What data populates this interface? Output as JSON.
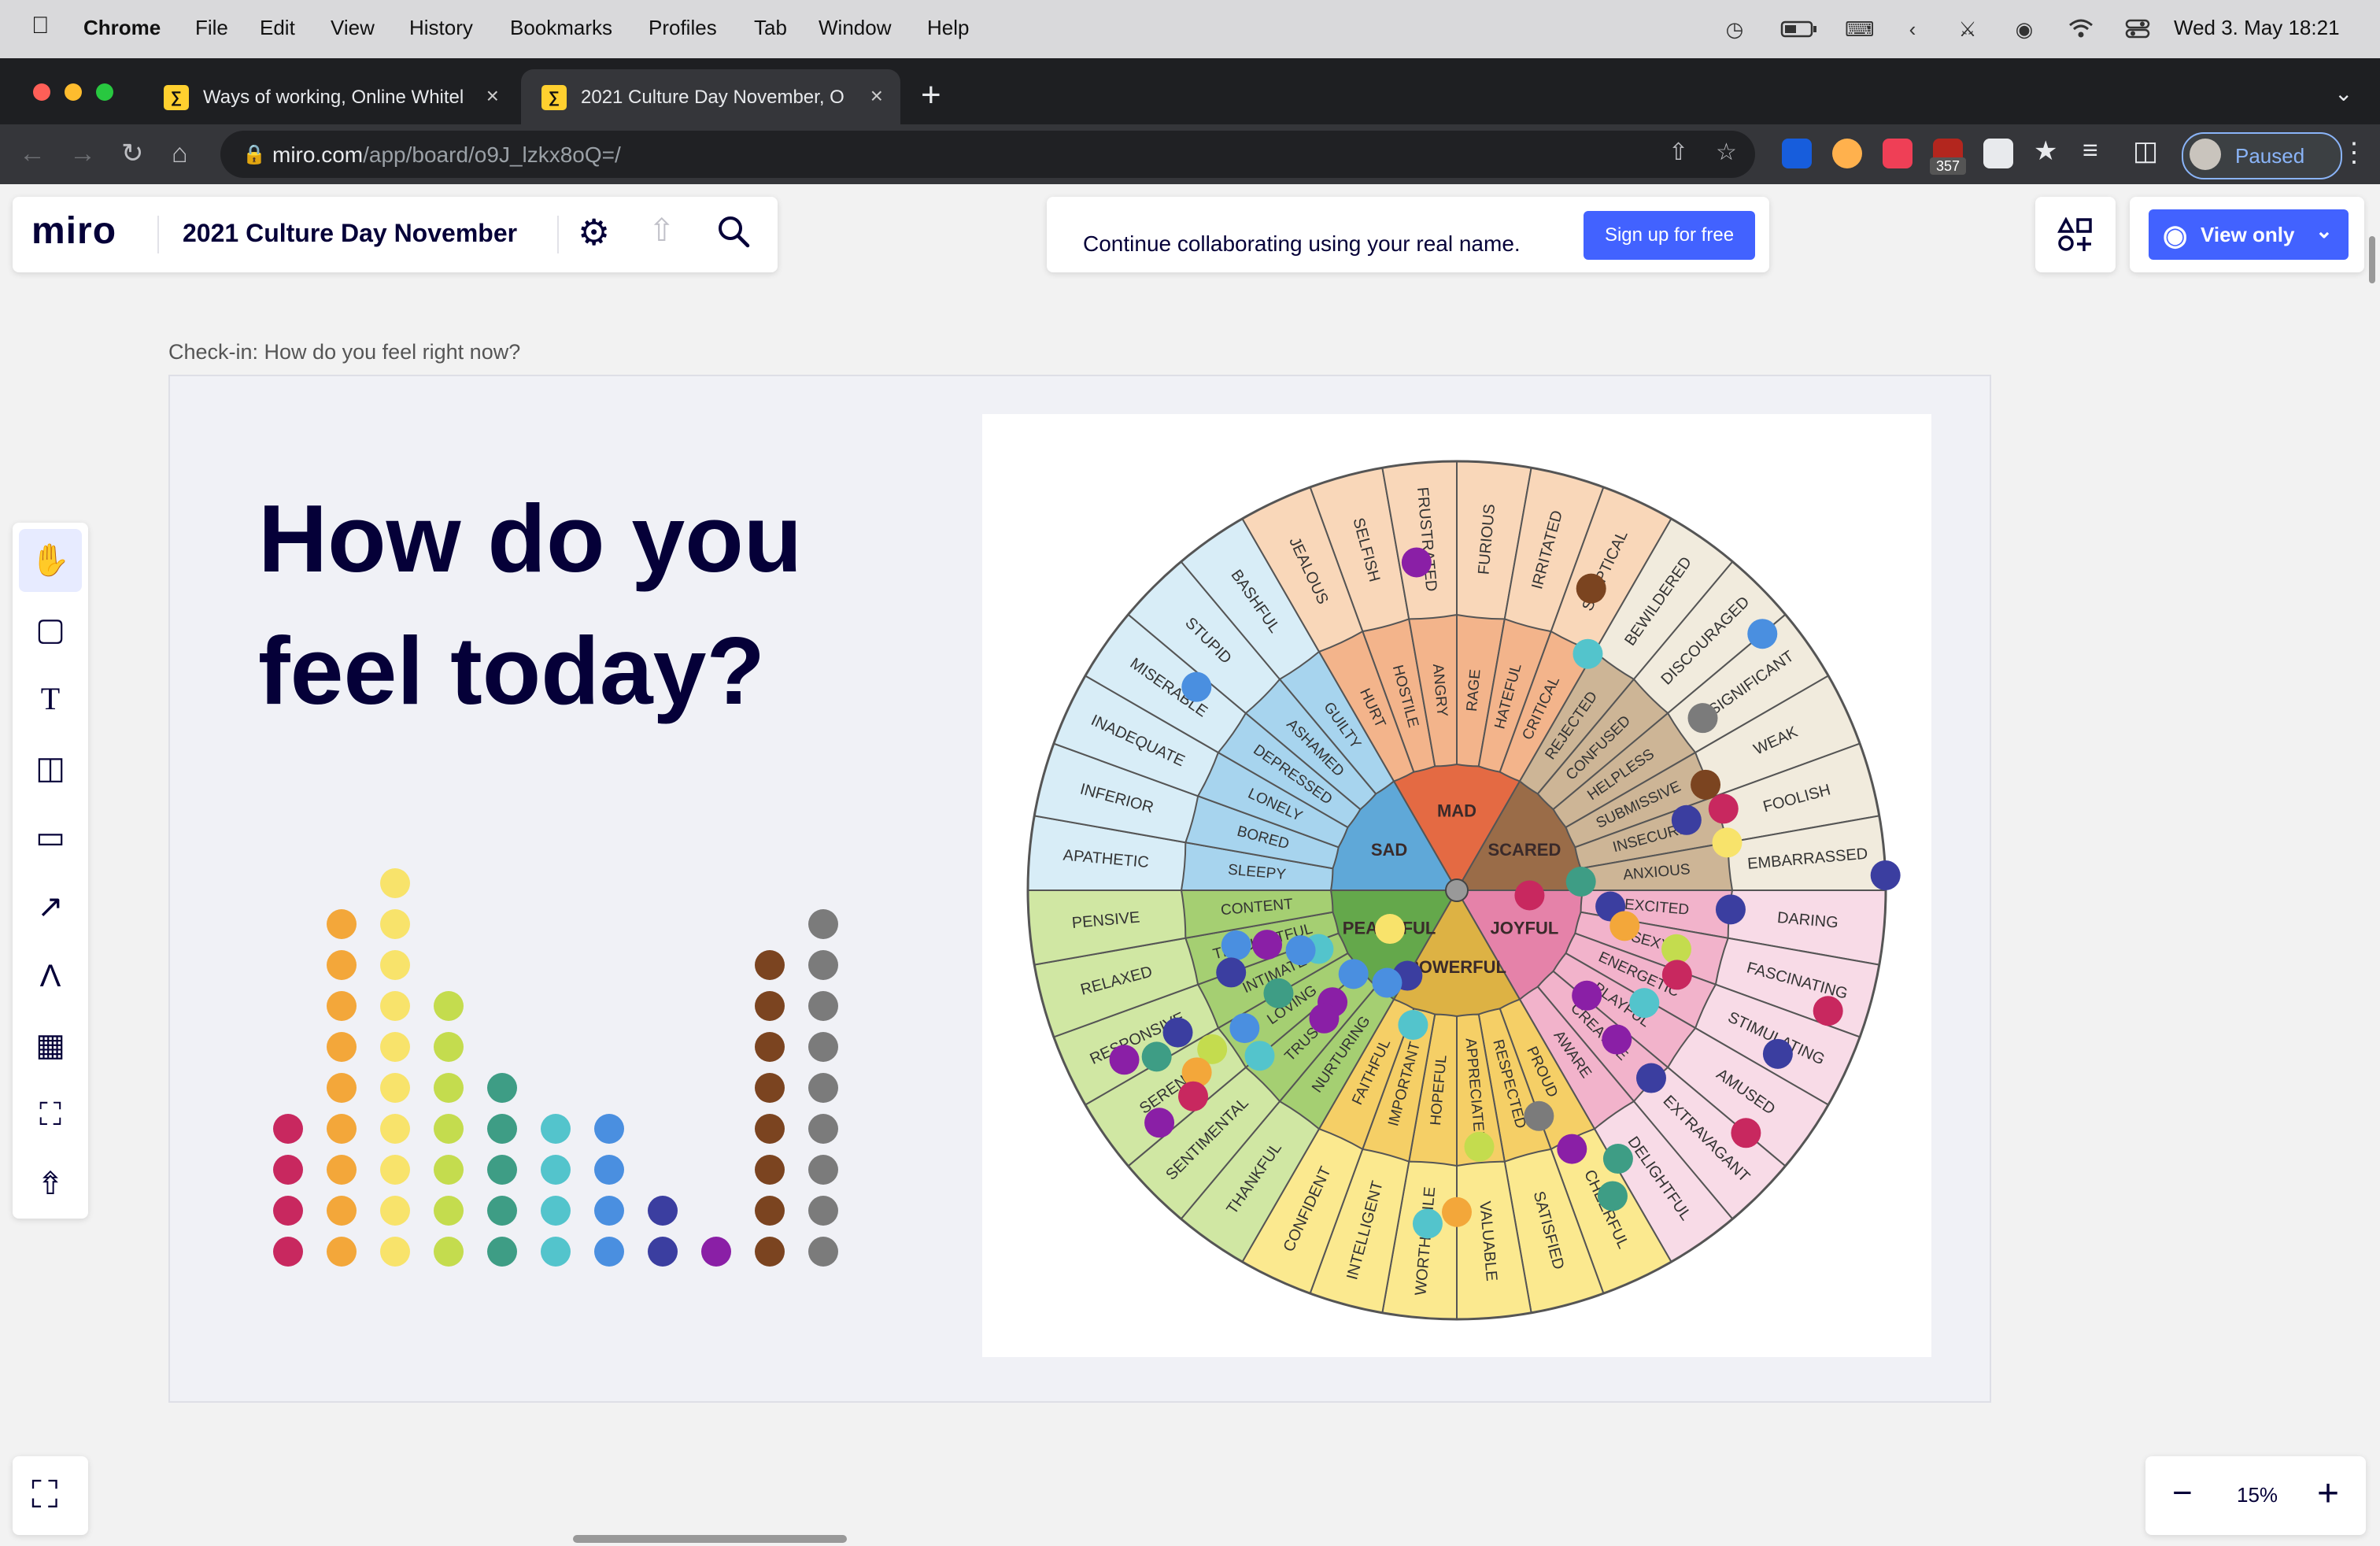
{
  "menubar": {
    "apple": "",
    "app": "Chrome",
    "items": [
      "File",
      "Edit",
      "View",
      "History",
      "Bookmarks",
      "Profiles",
      "Tab",
      "Window",
      "Help"
    ],
    "clock": "Wed 3. May  18:21"
  },
  "browser": {
    "tabs": [
      {
        "title": "Ways of working, Online Whitel",
        "favicon": "miro-icon"
      },
      {
        "title": "2021 Culture Day November, O",
        "favicon": "miro-icon"
      }
    ],
    "url_host": "miro.com",
    "url_path": "/app/board/o9J_lzkx8oQ=/",
    "extension_badge": "357",
    "profile_label": "Paused"
  },
  "miro": {
    "logo": "miro",
    "board_name": "2021 Culture Day November",
    "banner_text": "Continue collaborating using your real name.",
    "signup_label": "Sign up for free",
    "view_only_label": "View only",
    "zoom": "15%",
    "zoom_minus": "−",
    "zoom_plus": "+"
  },
  "frame": {
    "label": "Check-in: How do you feel right now?",
    "headline_line1": "How do you",
    "headline_line2": "feel today?"
  },
  "vote_columns": [
    {
      "color": "#c8285f",
      "count": 4
    },
    {
      "color": "#f3a73a",
      "count": 9
    },
    {
      "color": "#f8e36b",
      "count": 10
    },
    {
      "color": "#c4dc4e",
      "count": 7
    },
    {
      "color": "#3e9d85",
      "count": 5
    },
    {
      "color": "#53c4cc",
      "count": 4
    },
    {
      "color": "#4a8fe0",
      "count": 4
    },
    {
      "color": "#3b3ea0",
      "count": 2
    },
    {
      "color": "#8a1fa6",
      "count": 1
    },
    {
      "color": "#7b4420",
      "count": 8
    },
    {
      "color": "#7b7b7b",
      "count": 9
    }
  ],
  "wheel": {
    "core": [
      {
        "label": "MAD",
        "color": "#e46a43"
      },
      {
        "label": "SCARED",
        "color": "#9a6c48"
      },
      {
        "label": "JOYFUL",
        "color": "#e582a9"
      },
      {
        "label": "POWERFUL",
        "color": "#ddb244"
      },
      {
        "label": "PEACEFUL",
        "color": "#64a84b"
      },
      {
        "label": "SAD",
        "color": "#5fa8d8"
      }
    ],
    "middle": [
      {
        "label": "HOSTILE",
        "group": 0
      },
      {
        "label": "ANGRY",
        "group": 0
      },
      {
        "label": "RAGE",
        "group": 0
      },
      {
        "label": "HATEFUL",
        "group": 0
      },
      {
        "label": "CRITICAL",
        "group": 0
      },
      {
        "label": "REJECTED",
        "group": 1
      },
      {
        "label": "CONFUSED",
        "group": 1
      },
      {
        "label": "HELPLESS",
        "group": 1
      },
      {
        "label": "SUBMISSIVE",
        "group": 1
      },
      {
        "label": "INSECURE",
        "group": 1
      },
      {
        "label": "ANXIOUS",
        "group": 1
      },
      {
        "label": "EXCITED",
        "group": 2
      },
      {
        "label": "SEXY",
        "group": 2
      },
      {
        "label": "ENERGETIC",
        "group": 2
      },
      {
        "label": "PLAYFUL",
        "group": 2
      },
      {
        "label": "CREATIVE",
        "group": 2
      },
      {
        "label": "AWARE",
        "group": 2
      },
      {
        "label": "PROUD",
        "group": 3
      },
      {
        "label": "RESPECTED",
        "group": 3
      },
      {
        "label": "APPRECIATED",
        "group": 3
      },
      {
        "label": "HOPEFUL",
        "group": 3
      },
      {
        "label": "IMPORTANT",
        "group": 3
      },
      {
        "label": "FAITHFUL",
        "group": 3
      },
      {
        "label": "NURTURING",
        "group": 4
      },
      {
        "label": "TRUSTING",
        "group": 4
      },
      {
        "label": "LOVING",
        "group": 4
      },
      {
        "label": "INTIMATE",
        "group": 4
      },
      {
        "label": "THOUGHTFUL",
        "group": 4
      },
      {
        "label": "CONTENT",
        "group": 4
      },
      {
        "label": "SLEEPY",
        "group": 5
      },
      {
        "label": "BORED",
        "group": 5
      },
      {
        "label": "LONELY",
        "group": 5
      },
      {
        "label": "DEPRESSED",
        "group": 5
      },
      {
        "label": "ASHAMED",
        "group": 5
      },
      {
        "label": "GUILTY",
        "group": 5
      },
      {
        "label": "HURT",
        "group": 0
      }
    ],
    "outer": [
      {
        "label": "SELFISH",
        "group": 0
      },
      {
        "label": "FRUSTRATED",
        "group": 0
      },
      {
        "label": "FURIOUS",
        "group": 0
      },
      {
        "label": "IRRITATED",
        "group": 0
      },
      {
        "label": "SKEPTICAL",
        "group": 0
      },
      {
        "label": "BEWILDERED",
        "group": 1
      },
      {
        "label": "DISCOURAGED",
        "group": 1
      },
      {
        "label": "INSIGNIFICANT",
        "group": 1
      },
      {
        "label": "WEAK",
        "group": 1
      },
      {
        "label": "FOOLISH",
        "group": 1
      },
      {
        "label": "EMBARRASSED",
        "group": 1
      },
      {
        "label": "DARING",
        "group": 2
      },
      {
        "label": "FASCINATING",
        "group": 2
      },
      {
        "label": "STIMULATING",
        "group": 2
      },
      {
        "label": "AMUSED",
        "group": 2
      },
      {
        "label": "EXTRAVAGANT",
        "group": 2
      },
      {
        "label": "DELIGHTFUL",
        "group": 2
      },
      {
        "label": "CHEERFUL",
        "group": 3
      },
      {
        "label": "SATISFIED",
        "group": 3
      },
      {
        "label": "VALUABLE",
        "group": 3
      },
      {
        "label": "WORTHWHILE",
        "group": 3
      },
      {
        "label": "INTELLIGENT",
        "group": 3
      },
      {
        "label": "CONFIDENT",
        "group": 3
      },
      {
        "label": "THANKFUL",
        "group": 4
      },
      {
        "label": "SENTIMENTAL",
        "group": 4
      },
      {
        "label": "SERENE",
        "group": 4
      },
      {
        "label": "RESPONSIVE",
        "group": 4
      },
      {
        "label": "RELAXED",
        "group": 4
      },
      {
        "label": "PENSIVE",
        "group": 4
      },
      {
        "label": "APATHETIC",
        "group": 5
      },
      {
        "label": "INFERIOR",
        "group": 5
      },
      {
        "label": "INADEQUATE",
        "group": 5
      },
      {
        "label": "MISERABLE",
        "group": 5
      },
      {
        "label": "STUPID",
        "group": 5
      },
      {
        "label": "BASHFUL",
        "group": 5
      },
      {
        "label": "JEALOUS",
        "group": 0
      }
    ],
    "ring_colors": {
      "middle": [
        "#f3b48b",
        "#cdb596",
        "#f2b3cb",
        "#f5cf66",
        "#a5cf72",
        "#a7d4ee"
      ],
      "outer": [
        "#f9d7b9",
        "#f1ebdd",
        "#f8dbe7",
        "#fbe98f",
        "#d0e7a3",
        "#d8edf7"
      ]
    }
  },
  "wheel_votes": [
    {
      "color": "#7b4420",
      "angle": 24,
      "r": 0.77
    },
    {
      "color": "#8a1fa6",
      "angle": -7,
      "r": 0.77
    },
    {
      "color": "#53c4cc",
      "angle": 29,
      "r": 0.63
    },
    {
      "color": "#4a8fe0",
      "angle": 50,
      "r": 0.93
    },
    {
      "color": "#7b7b7b",
      "angle": 55,
      "r": 0.7
    },
    {
      "color": "#4a8fe0",
      "angle": -52,
      "r": 0.77
    },
    {
      "color": "#7b4420",
      "angle": 67,
      "r": 0.63
    },
    {
      "color": "#c8285f",
      "angle": 73,
      "r": 0.65
    },
    {
      "color": "#3b3ea0",
      "angle": 73,
      "r": 0.56
    },
    {
      "color": "#3b3ea0",
      "angle": 88,
      "r": 1.0
    },
    {
      "color": "#f8e36b",
      "angle": 80,
      "r": 0.64
    },
    {
      "color": "#3e9d85",
      "angle": 86,
      "r": 0.29
    },
    {
      "color": "#c8285f",
      "angle": 94,
      "r": 0.17
    },
    {
      "color": "#3b3ea0",
      "angle": 96,
      "r": 0.36
    },
    {
      "color": "#3b3ea0",
      "angle": 94,
      "r": 0.64
    },
    {
      "color": "#f3a73a",
      "angle": 102,
      "r": 0.4
    },
    {
      "color": "#c4dc4e",
      "angle": 105,
      "r": 0.53
    },
    {
      "color": "#c8285f",
      "angle": 111,
      "r": 0.55
    },
    {
      "color": "#c8285f",
      "angle": 108,
      "r": 0.91
    },
    {
      "color": "#8a1fa6",
      "angle": 129,
      "r": 0.39
    },
    {
      "color": "#53c4cc",
      "angle": 121,
      "r": 0.51
    },
    {
      "color": "#3b3ea0",
      "angle": 117,
      "r": 0.84
    },
    {
      "color": "#8a1fa6",
      "angle": 133,
      "r": 0.51
    },
    {
      "color": "#3b3ea0",
      "angle": 134,
      "r": 0.63
    },
    {
      "color": "#7b7b7b",
      "angle": 160,
      "r": 0.56
    },
    {
      "color": "#8a1fa6",
      "angle": 156,
      "r": 0.66
    },
    {
      "color": "#3e9d85",
      "angle": 149,
      "r": 0.73
    },
    {
      "color": "#c8285f",
      "angle": 130,
      "r": 0.88
    },
    {
      "color": "#3e9d85",
      "angle": 153,
      "r": 0.8
    },
    {
      "color": "#c4dc4e",
      "angle": 175,
      "r": 0.6
    },
    {
      "color": "#f3a73a",
      "angle": 180,
      "r": 0.75
    },
    {
      "color": "#53c4cc",
      "angle": 185,
      "r": 0.78
    },
    {
      "color": "#f8e36b",
      "angle": -120,
      "r": 0.18
    },
    {
      "color": "#3b3ea0",
      "angle": -150,
      "r": 0.23
    },
    {
      "color": "#4a8fe0",
      "angle": -143,
      "r": 0.27
    },
    {
      "color": "#4a8fe0",
      "angle": -129,
      "r": 0.31
    },
    {
      "color": "#53c4cc",
      "angle": -162,
      "r": 0.33
    },
    {
      "color": "#8a1fa6",
      "angle": -132,
      "r": 0.39
    },
    {
      "color": "#53c4cc",
      "angle": -113,
      "r": 0.35
    },
    {
      "color": "#4a8fe0",
      "angle": -111,
      "r": 0.39
    },
    {
      "color": "#8a1fa6",
      "angle": -106,
      "r": 0.46
    },
    {
      "color": "#4a8fe0",
      "angle": -104,
      "r": 0.53
    },
    {
      "color": "#3e9d85",
      "angle": -120,
      "r": 0.48
    },
    {
      "color": "#3b3ea0",
      "angle": -110,
      "r": 0.56
    },
    {
      "color": "#4a8fe0",
      "angle": -123,
      "r": 0.59
    },
    {
      "color": "#c4dc4e",
      "angle": -123,
      "r": 0.68
    },
    {
      "color": "#3b3ea0",
      "angle": -117,
      "r": 0.73
    },
    {
      "color": "#3e9d85",
      "angle": -119,
      "r": 0.8
    },
    {
      "color": "#8a1fa6",
      "angle": -117,
      "r": 0.87
    },
    {
      "color": "#f3a73a",
      "angle": -125,
      "r": 0.74
    },
    {
      "color": "#c8285f",
      "angle": -128,
      "r": 0.78
    },
    {
      "color": "#8a1fa6",
      "angle": -128,
      "r": 0.88
    },
    {
      "color": "#8a1fa6",
      "angle": -134,
      "r": 0.43
    },
    {
      "color": "#53c4cc",
      "angle": -130,
      "r": 0.6
    }
  ]
}
